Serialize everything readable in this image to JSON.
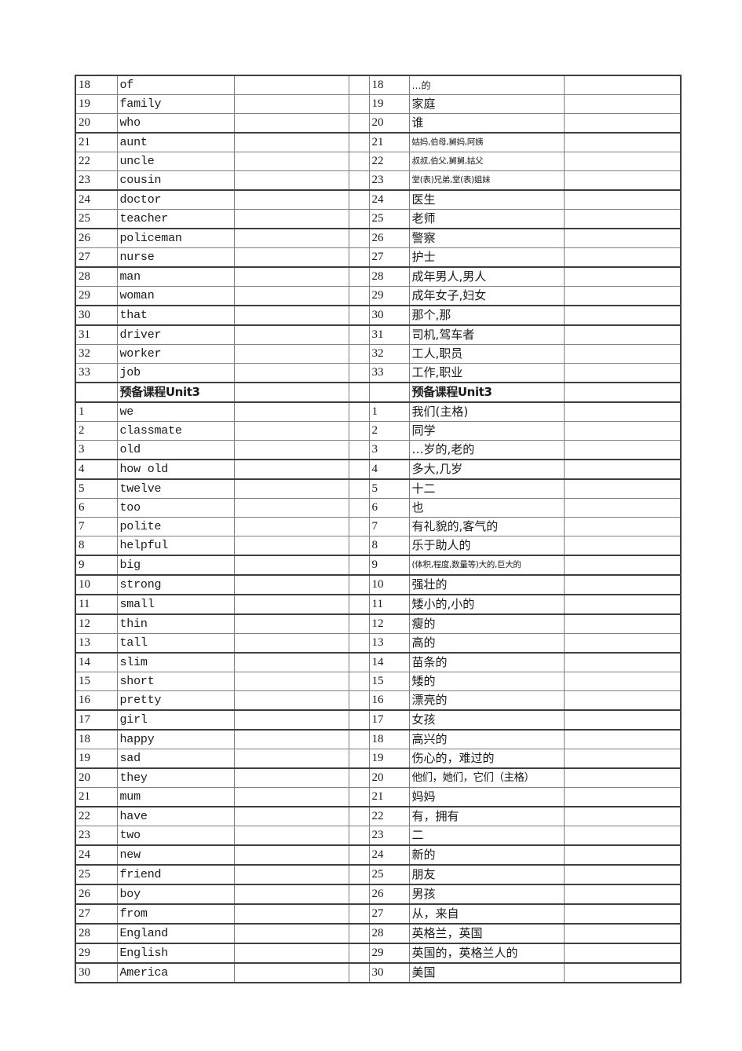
{
  "document": {
    "title": "英语单词表",
    "type": "spreadsheet-vocabulary-list"
  },
  "columns": {
    "index_left": "",
    "english": "",
    "blank_left": "",
    "gap": "",
    "index_right": "",
    "chinese": "",
    "blank_right": ""
  },
  "rows": [
    {
      "n": "18",
      "en": "of",
      "n2": "18",
      "zh": "…的",
      "size": "sm",
      "thick": false
    },
    {
      "n": "19",
      "en": "family",
      "n2": "19",
      "zh": "家庭",
      "size": "",
      "thick": false
    },
    {
      "n": "20",
      "en": "who",
      "n2": "20",
      "zh": "谁",
      "size": "",
      "thick": false
    },
    {
      "n": "21",
      "en": "aunt",
      "n2": "21",
      "zh": "姑妈,伯母,舅妈,阿姨",
      "size": "xs",
      "thick": true
    },
    {
      "n": "22",
      "en": "uncle",
      "n2": "22",
      "zh": "叔叔,伯父,舅舅,姑父",
      "size": "xs",
      "thick": false
    },
    {
      "n": "23",
      "en": "cousin",
      "n2": "23",
      "zh": "堂(表)兄弟,堂(表)姐妹",
      "size": "xs",
      "thick": false
    },
    {
      "n": "24",
      "en": "doctor",
      "n2": "24",
      "zh": "医生",
      "size": "",
      "thick": true
    },
    {
      "n": "25",
      "en": "teacher",
      "n2": "25",
      "zh": "老师",
      "size": "",
      "thick": false
    },
    {
      "n": "26",
      "en": "policeman",
      "n2": "26",
      "zh": "警察",
      "size": "",
      "thick": true
    },
    {
      "n": "27",
      "en": "nurse",
      "n2": "27",
      "zh": "护士",
      "size": "",
      "thick": false
    },
    {
      "n": "28",
      "en": "man",
      "n2": "28",
      "zh": "成年男人,男人",
      "size": "",
      "thick": true
    },
    {
      "n": "29",
      "en": "woman",
      "n2": "29",
      "zh": "成年女子,妇女",
      "size": "",
      "thick": false
    },
    {
      "n": "30",
      "en": "that",
      "n2": "30",
      "zh": "那个,那",
      "size": "",
      "thick": true
    },
    {
      "n": "31",
      "en": "driver",
      "n2": "31",
      "zh": "司机,驾车者",
      "size": "",
      "thick": true
    },
    {
      "n": "32",
      "en": "worker",
      "n2": "32",
      "zh": "工人,职员",
      "size": "",
      "thick": false
    },
    {
      "n": "33",
      "en": "job",
      "n2": "33",
      "zh": "工作,职业",
      "size": "",
      "thick": false
    },
    {
      "n": "",
      "en": "预备课程Unit3",
      "n2": "",
      "zh": "预备课程Unit3",
      "size": "",
      "thick": true,
      "section": true
    },
    {
      "n": "1",
      "en": "we",
      "n2": "1",
      "zh": "我们(主格)",
      "size": "",
      "thick": true
    },
    {
      "n": "2",
      "en": "classmate",
      "n2": "2",
      "zh": "同学",
      "size": "",
      "thick": false
    },
    {
      "n": "3",
      "en": "old",
      "n2": "3",
      "zh": "…岁的,老的",
      "size": "",
      "thick": false
    },
    {
      "n": "4",
      "en": "how old",
      "n2": "4",
      "zh": "多大,几岁",
      "size": "",
      "thick": true
    },
    {
      "n": "5",
      "en": "twelve",
      "n2": "5",
      "zh": "十二",
      "size": "",
      "thick": true
    },
    {
      "n": "6",
      "en": "too",
      "n2": "6",
      "zh": "也",
      "size": "",
      "thick": false
    },
    {
      "n": "7",
      "en": "polite",
      "n2": "7",
      "zh": "有礼貌的,客气的",
      "size": "",
      "thick": false
    },
    {
      "n": "8",
      "en": "helpful",
      "n2": "8",
      "zh": "乐于助人的",
      "size": "",
      "thick": false
    },
    {
      "n": "9",
      "en": "big",
      "n2": "9",
      "zh": "(体积,程度,数量等)大的,巨大的",
      "size": "xs",
      "thick": true
    },
    {
      "n": "10",
      "en": "strong",
      "n2": "10",
      "zh": "强壮的",
      "size": "",
      "thick": true
    },
    {
      "n": "11",
      "en": "small",
      "n2": "11",
      "zh": "矮小的,小的",
      "size": "",
      "thick": true
    },
    {
      "n": "12",
      "en": "thin",
      "n2": "12",
      "zh": "瘦的",
      "size": "",
      "thick": true
    },
    {
      "n": "13",
      "en": "tall",
      "n2": "13",
      "zh": "高的",
      "size": "",
      "thick": false
    },
    {
      "n": "14",
      "en": "slim",
      "n2": "14",
      "zh": "苗条的",
      "size": "",
      "thick": true
    },
    {
      "n": "15",
      "en": "short",
      "n2": "15",
      "zh": "矮的",
      "size": "",
      "thick": false
    },
    {
      "n": "16",
      "en": "pretty",
      "n2": "16",
      "zh": "漂亮的",
      "size": "",
      "thick": false
    },
    {
      "n": "17",
      "en": "girl",
      "n2": "17",
      "zh": "女孩",
      "size": "",
      "thick": true
    },
    {
      "n": "18",
      "en": "happy",
      "n2": "18",
      "zh": "高兴的",
      "size": "",
      "thick": true
    },
    {
      "n": "19",
      "en": "sad",
      "n2": "19",
      "zh": "伤心的，难过的",
      "size": "",
      "thick": false
    },
    {
      "n": "20",
      "en": "they",
      "n2": "20",
      "zh": "他们，她们，它们（主格）",
      "size": "md",
      "thick": true
    },
    {
      "n": "21",
      "en": "mum",
      "n2": "21",
      "zh": "妈妈",
      "size": "",
      "thick": false
    },
    {
      "n": "22",
      "en": "have",
      "n2": "22",
      "zh": "有，拥有",
      "size": "",
      "thick": true
    },
    {
      "n": "23",
      "en": "two",
      "n2": "23",
      "zh": "二",
      "size": "",
      "thick": false
    },
    {
      "n": "24",
      "en": "new",
      "n2": "24",
      "zh": "新的",
      "size": "",
      "thick": true
    },
    {
      "n": "25",
      "en": "friend",
      "n2": "25",
      "zh": "朋友",
      "size": "",
      "thick": true
    },
    {
      "n": "26",
      "en": "boy",
      "n2": "26",
      "zh": "男孩",
      "size": "",
      "thick": true
    },
    {
      "n": "27",
      "en": "from",
      "n2": "27",
      "zh": "从，来自",
      "size": "",
      "thick": true
    },
    {
      "n": "28",
      "en": "England",
      "n2": "28",
      "zh": "英格兰，英国",
      "size": "",
      "thick": true
    },
    {
      "n": "29",
      "en": "English",
      "n2": "29",
      "zh": "英国的，英格兰人的",
      "size": "",
      "thick": true
    },
    {
      "n": "30",
      "en": "America",
      "n2": "30",
      "zh": "美国",
      "size": "",
      "thick": true
    }
  ]
}
